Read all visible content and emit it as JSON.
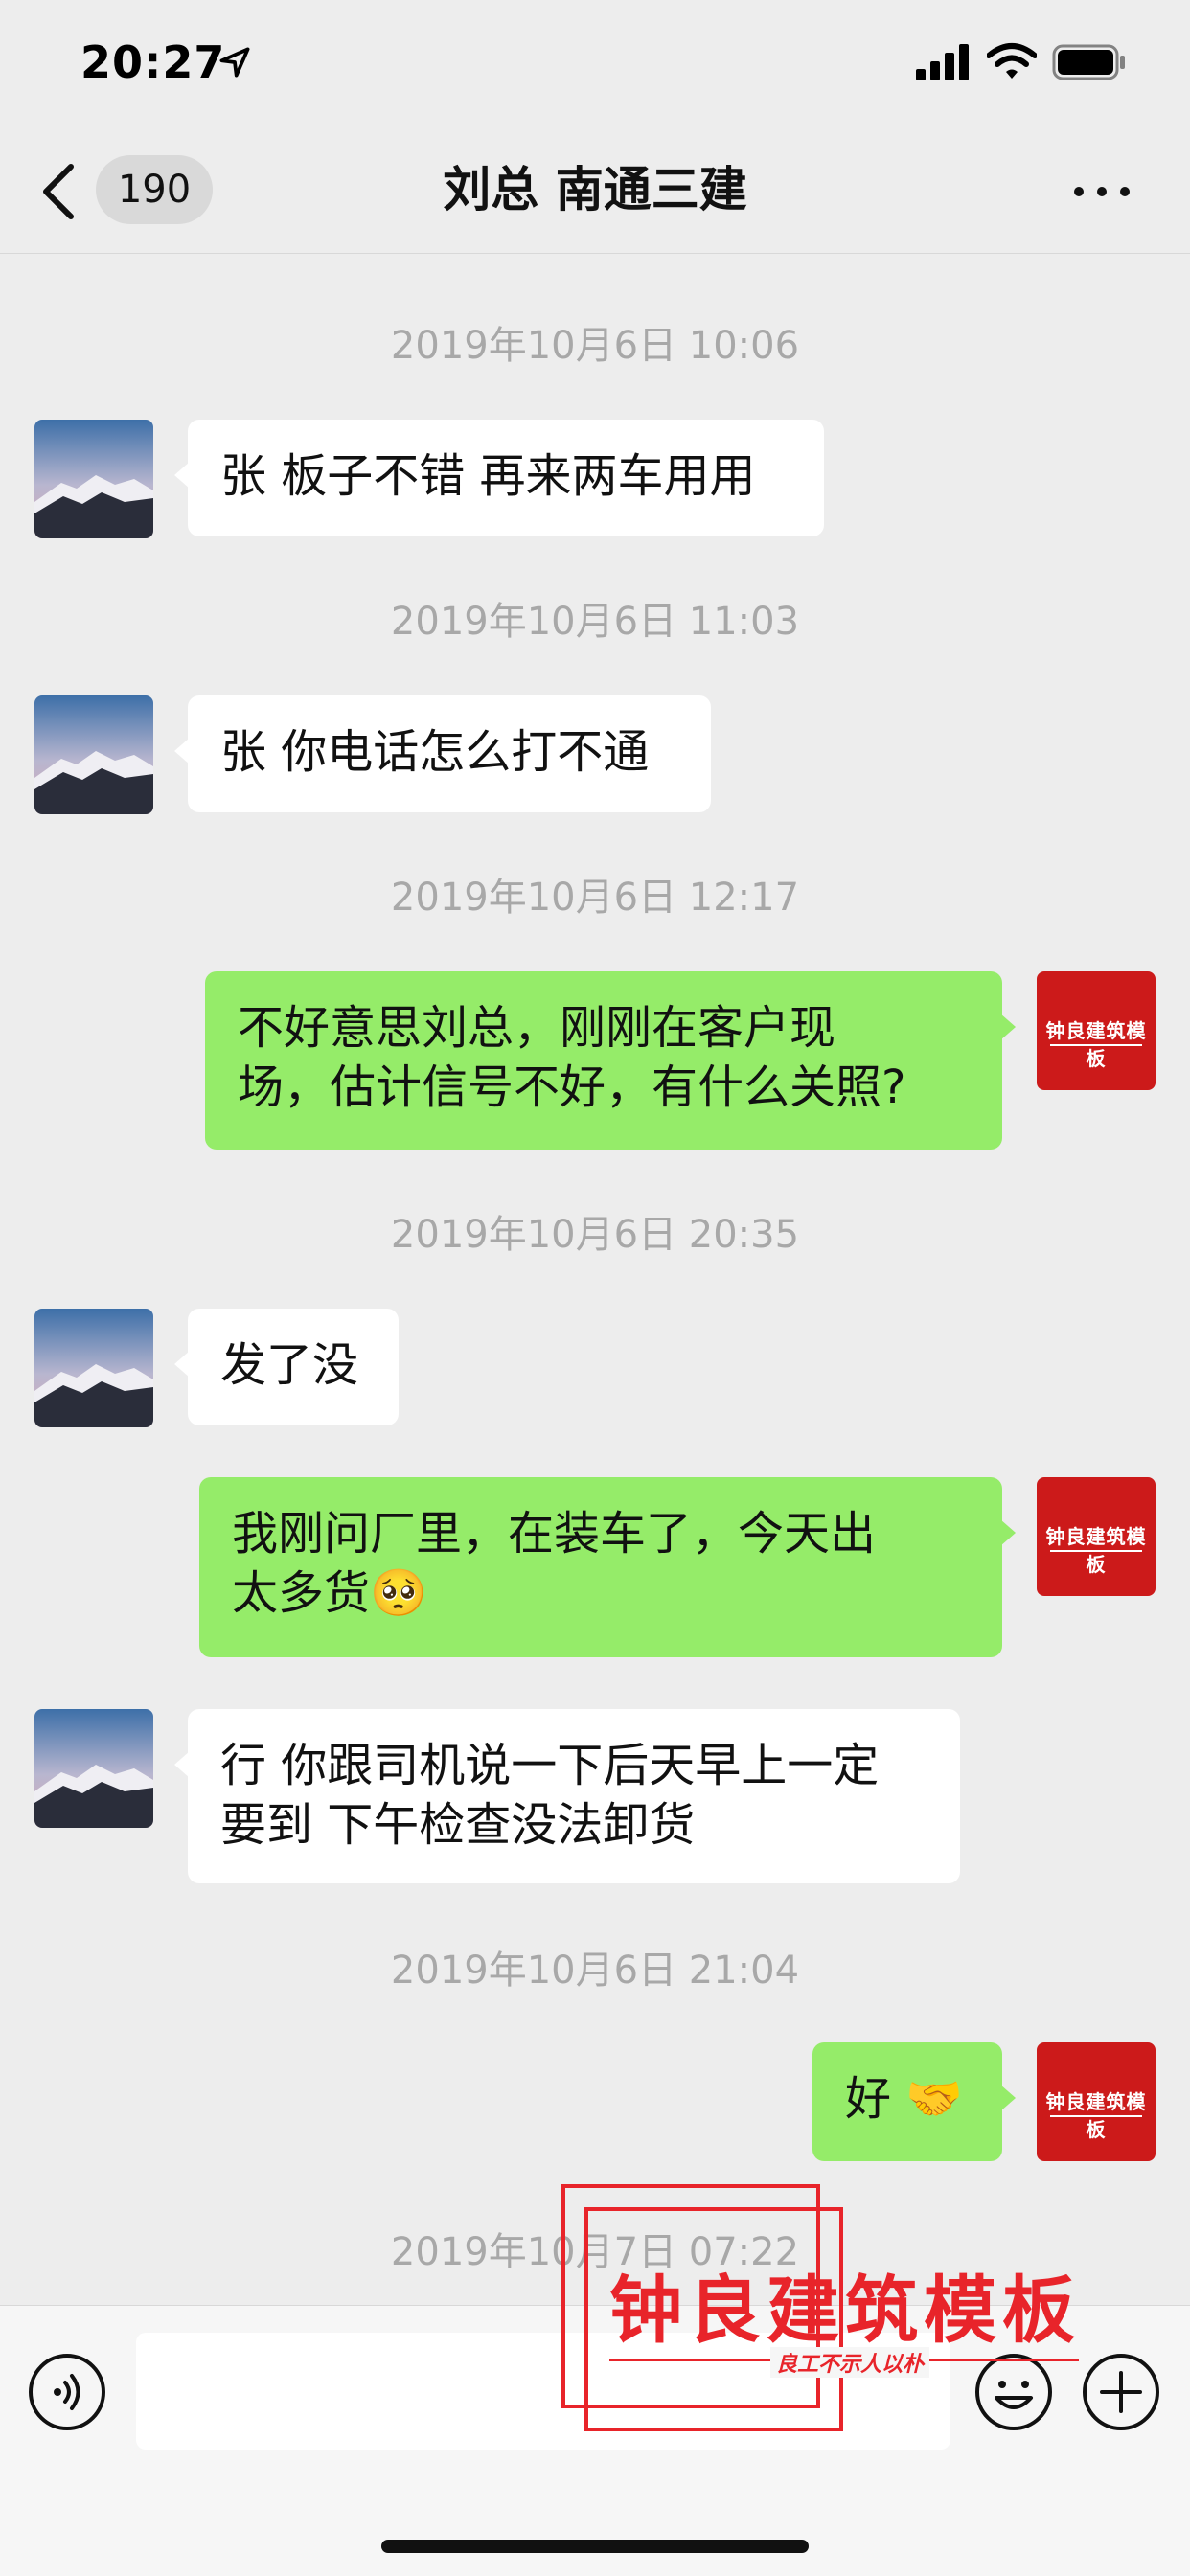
{
  "status_bar": {
    "time": "20:27"
  },
  "nav": {
    "badge_count": "190",
    "title": "刘总 南通三建"
  },
  "messages": [
    {
      "time": "2019年10月6日 10:06"
    },
    {
      "text": "张 板子不错 再来两车用用"
    },
    {
      "time": "2019年10月6日 11:03"
    },
    {
      "text": "张 你电话怎么打不通"
    },
    {
      "time": "2019年10月6日 12:17"
    },
    {
      "line1": "不好意思刘总，刚刚在客户现",
      "line2": "场，估计信号不好，有什么关照?"
    },
    {
      "time": "2019年10月6日 20:35"
    },
    {
      "text": "发了没"
    },
    {
      "line1": "我刚问厂里，在装车了，今天出",
      "line2": "太多货🥺"
    },
    {
      "line1": "行 你跟司机说一下后天早上一定",
      "line2": "要到 下午检查没法卸货"
    },
    {
      "time": "2019年10月6日 21:04"
    },
    {
      "text": "好 🤝"
    },
    {
      "time": "2019年10月7日 07:22"
    }
  ],
  "logo": {
    "text": "钟良建筑模板"
  },
  "watermark": {
    "text": "钟良建筑模板",
    "slogan": "良工不示人以朴"
  },
  "colors": {
    "accent_green": "#95ec69",
    "watermark_red": "#e8242a",
    "logo_red": "#cc1a1a"
  },
  "icons": [
    "location-arrow-icon",
    "signal-icon",
    "wifi-icon",
    "battery-icon",
    "back-chevron-icon",
    "more-icon",
    "voice-icon",
    "emoji-icon",
    "plus-icon"
  ]
}
